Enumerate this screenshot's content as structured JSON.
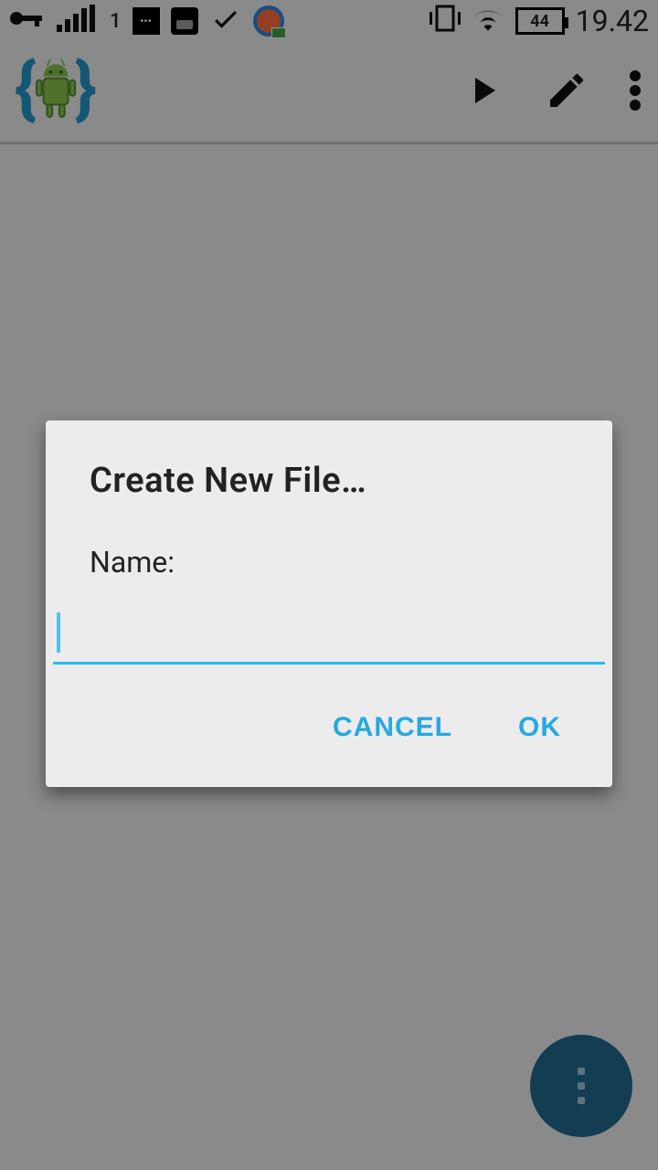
{
  "status_bar": {
    "clock": "19.42",
    "battery_percent": "44",
    "signal_index": "1"
  },
  "app_bar": {
    "icons": {
      "play": "play-icon",
      "edit": "edit-icon",
      "overflow": "overflow-icon"
    }
  },
  "dialog": {
    "title": "Create New File…",
    "label": "Name:",
    "input_value": "",
    "cancel_label": "CANCEL",
    "ok_label": "OK"
  },
  "fab": {
    "name": "more-fab"
  },
  "colors": {
    "accent": "#29b6f6",
    "fab": "#1f6a8f",
    "scrim": "rgba(0,0,0,0.42)"
  }
}
